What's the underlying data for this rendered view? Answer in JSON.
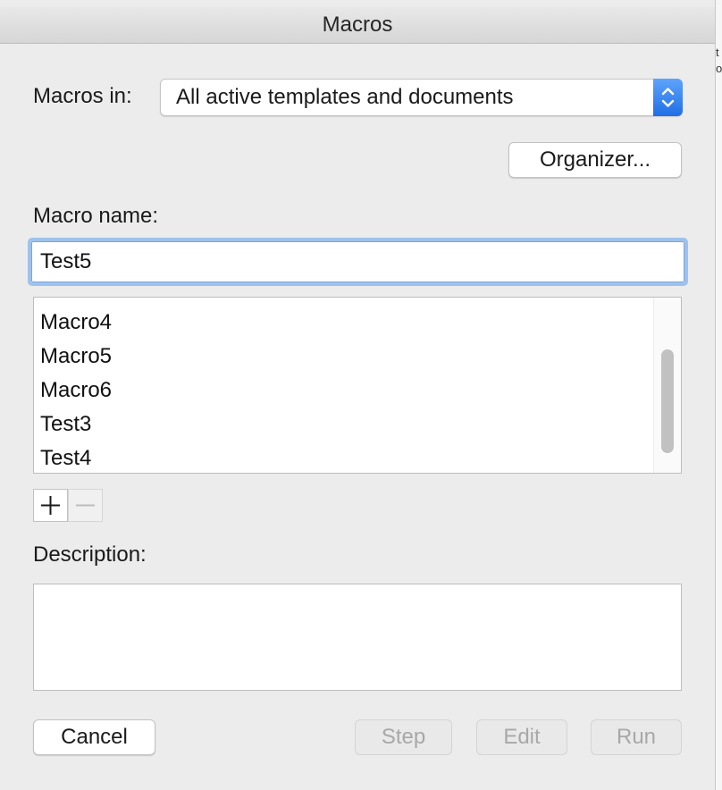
{
  "dialog": {
    "title": "Macros"
  },
  "macros_in": {
    "label": "Macros in:",
    "selected": "All active templates and documents"
  },
  "organizer_button": "Organizer...",
  "macro_name": {
    "label": "Macro name:",
    "value": "Test5"
  },
  "macro_list": {
    "items": [
      "Macro4",
      "Macro5",
      "Macro6",
      "Test3",
      "Test4"
    ],
    "scroll_position": 0.75
  },
  "list_controls": {
    "add_icon": "plus-icon",
    "remove_icon": "minus-icon"
  },
  "description": {
    "label": "Description:",
    "value": ""
  },
  "buttons": {
    "cancel": "Cancel",
    "step": "Step",
    "edit": "Edit",
    "run": "Run"
  },
  "colors": {
    "accent": "#2f7df0",
    "focus_ring": "#9ec2ee",
    "disabled_text": "#a8a8a8"
  }
}
